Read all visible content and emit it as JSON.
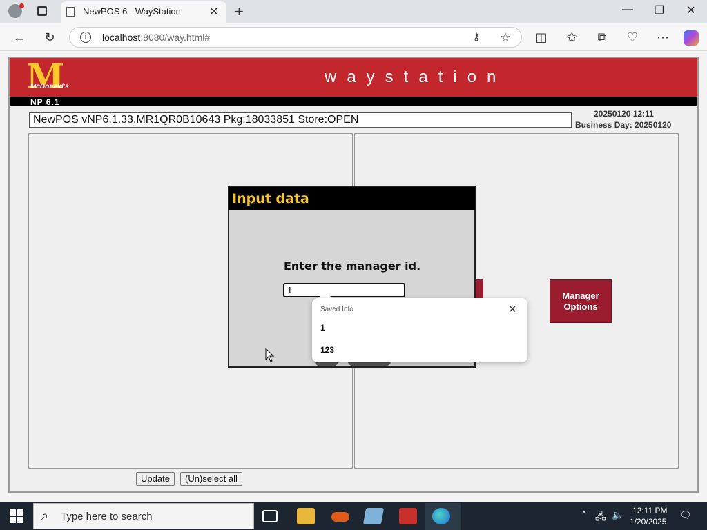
{
  "browser": {
    "tab_title": "NewPOS 6 - WayStation",
    "url_host": "localhost",
    "url_rest": ":8080/way.html#"
  },
  "pos": {
    "brand_logo": "McDonald's",
    "title": "waystation",
    "np_version": "NP 6.1",
    "info": "NewPOS vNP6.1.33.MR1QR0B10643 Pkg:18033851 Store:OPEN",
    "date": "20250120 12:11",
    "business_day": "Business Day: 20250120",
    "manager_button": "Manager Options",
    "update_button": "Update",
    "select_all_button": "(Un)select all"
  },
  "dialog": {
    "title": "Input data",
    "prompt": "Enter the manager id.",
    "input_value": "1"
  },
  "autofill": {
    "header": "Saved Info",
    "items": [
      "1",
      "123"
    ]
  },
  "taskbar": {
    "search_placeholder": "Type here to search",
    "time": "12:11 PM",
    "date": "1/20/2025"
  },
  "colors": {
    "header_red": "#c1272d",
    "button_maroon": "#9b1c2e",
    "dialog_title_yellow": "#f1c232",
    "logo_yellow": "#ffc72c"
  }
}
